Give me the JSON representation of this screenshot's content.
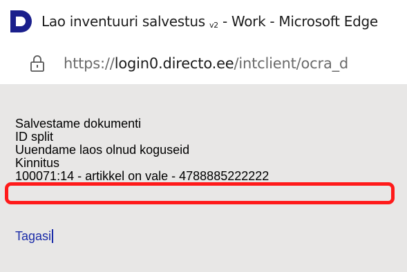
{
  "window": {
    "title_main": "Lao inventuuri salvestus",
    "title_version": "v2",
    "title_rest": " - Work - Microsoft Edge",
    "logo_icon": "directo-logo-icon",
    "logo_color": "#1a1f8c"
  },
  "address_bar": {
    "lock_icon": "lock-icon",
    "url_protocol": "https://",
    "url_host": "login0.directo.ee",
    "url_path": "/intclient/ocra_d"
  },
  "content": {
    "messages": [
      "Salvestame dokumenti",
      "ID split",
      "Uuendame laos olnud koguseid",
      "Kinnitus",
      "100071:14 - artikkel on vale - 4788885222222"
    ],
    "highlight_color": "#ff1a1a",
    "back_link": "Tagasi"
  }
}
